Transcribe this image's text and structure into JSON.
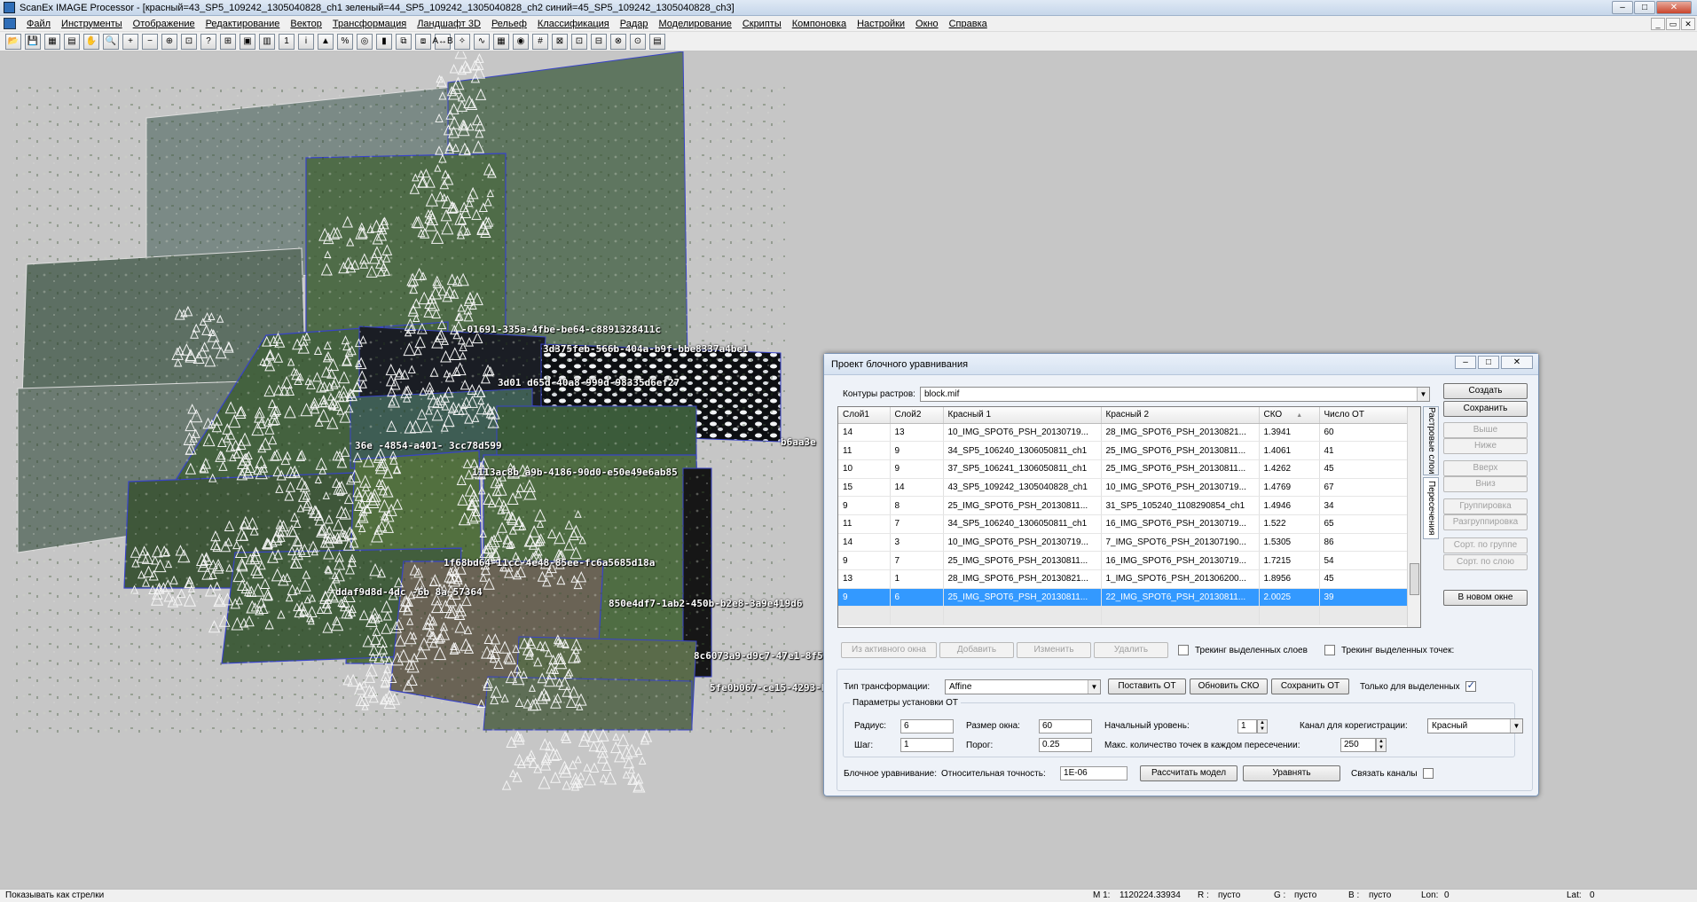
{
  "window": {
    "title": "ScanEx IMAGE Processor - [красный=43_SP5_109242_1305040828_ch1 зеленый=44_SP5_109242_1305040828_ch2 синий=45_SP5_109242_1305040828_ch3]",
    "controls": [
      "–",
      "□",
      "✕"
    ]
  },
  "menu": [
    "Файл",
    "Инструменты",
    "Отображение",
    "Редактирование",
    "Вектор",
    "Трансформация",
    "Ландшафт 3D",
    "Рельеф",
    "Классификация",
    "Радар",
    "Моделирование",
    "Скрипты",
    "Компоновка",
    "Настройки",
    "Окно",
    "Справка"
  ],
  "mdi_controls": [
    "_",
    "▭",
    "✕"
  ],
  "toolbar_icons": [
    "open-icon",
    "save-icon",
    "image-icon",
    "window-icon",
    "hand-icon",
    "zoom-icon",
    "zoom-in-icon",
    "zoom-out-icon",
    "zoom-fit-icon",
    "zoom-rect-icon",
    "measure-icon",
    "frame-icon",
    "overview-icon",
    "layer-icon",
    "one-icon",
    "info-icon",
    "histogram-icon",
    "percent-icon",
    "palette-icon",
    "gradient-icon",
    "copy-icon",
    "paste-icon",
    "ab-icon",
    "rotate-icon",
    "curve-icon",
    "table-icon",
    "globe-icon",
    "grid-icon",
    "stamp-icon",
    "stamp2-icon",
    "stamp3-icon",
    "stamp4-icon",
    "stamp5-icon",
    "list-icon"
  ],
  "toolbar_glyphs": [
    "📂",
    "💾",
    "▦",
    "▤",
    "✋",
    "🔍",
    "+",
    "−",
    "⊕",
    "⊡",
    "?",
    "⊞",
    "▣",
    "▥",
    "1",
    "i",
    "▲",
    "%",
    "◎",
    "▮",
    "⧉",
    "⧈",
    "A↔B",
    "✧",
    "∿",
    "▦",
    "◉",
    "#",
    "⊠",
    "⊡",
    "⊟",
    "⊗",
    "⊙",
    "▤"
  ],
  "map_labels": [
    "-01691-335a-4fbe-be64-c8891328411c",
    "3d375feb-566b-404a-b9f-bbe8337a4be1",
    "3d01      d65d-40a8-999d-98335d6ef27",
    "36e       -4854-a401-      3cc78d599",
    "b6aa3e",
    "1113ac8b    a9b-4186-90d0-e50e49e6ab85",
    "1f68bd64-11cc-4e48-85ee-fc6a5685d18a",
    "ddaf9d8d-4dc   -6b    8a        57364",
    "850e4df7-1ab2-450b-b2e8-3a9e419d6",
    "8c6073a9-d9c7-47e1-8f54-5dd5c6b2d636",
    "5fe0b067-ce15-4293-bd63-0733e4b4db23"
  ],
  "dialog": {
    "title": "Проект блочного уравнивания",
    "contours_label": "Контуры растров:",
    "contours_value": "block.mif",
    "columns": [
      "Слой1",
      "Слой2",
      "Красный 1",
      "Красный 2",
      "СКО",
      "Число ОТ"
    ],
    "sort_indicator": "▲",
    "rows": [
      [
        "14",
        "13",
        "10_IMG_SPOT6_PSH_20130719...",
        "28_IMG_SPOT6_PSH_20130821...",
        "1.3941",
        "60"
      ],
      [
        "11",
        "9",
        "34_SP5_106240_1306050811_ch1",
        "25_IMG_SPOT6_PSH_20130811...",
        "1.4061",
        "41"
      ],
      [
        "10",
        "9",
        "37_SP5_106241_1306050811_ch1",
        "25_IMG_SPOT6_PSH_20130811...",
        "1.4262",
        "45"
      ],
      [
        "15",
        "14",
        "43_SP5_109242_1305040828_ch1",
        "10_IMG_SPOT6_PSH_20130719...",
        "1.4769",
        "67"
      ],
      [
        "9",
        "8",
        "25_IMG_SPOT6_PSH_20130811...",
        "31_SP5_105240_1108290854_ch1",
        "1.4946",
        "34"
      ],
      [
        "11",
        "7",
        "34_SP5_106240_1306050811_ch1",
        "16_IMG_SPOT6_PSH_20130719...",
        "1.522",
        "65"
      ],
      [
        "14",
        "3",
        "10_IMG_SPOT6_PSH_20130719...",
        "7_IMG_SPOT6_PSH_201307190...",
        "1.5305",
        "86"
      ],
      [
        "9",
        "7",
        "25_IMG_SPOT6_PSH_20130811...",
        "16_IMG_SPOT6_PSH_20130719...",
        "1.7215",
        "54"
      ],
      [
        "13",
        "1",
        "28_IMG_SPOT6_PSH_20130821...",
        "1_IMG_SPOT6_PSH_201306200...",
        "1.8956",
        "45"
      ],
      [
        "9",
        "6",
        "25_IMG_SPOT6_PSH_20130811...",
        "22_IMG_SPOT6_PSH_20130811...",
        "2.0025",
        "39"
      ]
    ],
    "selected_row_index": 9,
    "side_tabs": [
      "Растровые слои",
      "Пересечения"
    ],
    "side_buttons": [
      "Создать",
      "Сохранить",
      "Выше",
      "Ниже",
      "Вверх",
      "Вниз",
      "Группировка",
      "Разгруппировка",
      "Сорт. по группе",
      "Сорт. по слою",
      "В новом окне"
    ],
    "action_buttons": [
      "Из активного окна",
      "Добавить",
      "Изменить",
      "Удалить"
    ],
    "track_layers_label": "Трекинг выделенных слоев",
    "track_points_label": "Трекинг выделенных точек:",
    "transform_label": "Тип трансформации:",
    "transform_value": "Affine",
    "btn_set_points": "Поставить ОТ",
    "btn_update_rmse": "Обновить СКО",
    "btn_save_points": "Сохранить ОТ",
    "only_selected_label": "Только для выделенных",
    "params_group": "Параметры установки ОТ",
    "radius_label": "Радиус:",
    "radius_value": "6",
    "window_label": "Размер окна:",
    "window_value": "60",
    "start_level_label": "Начальный уровень:",
    "start_level_value": "1",
    "channel_label": "Канал для корегистрации:",
    "channel_value": "Красный",
    "step_label": "Шаг:",
    "step_value": "1",
    "threshold_label": "Порог:",
    "threshold_value": "0.25",
    "maxpoints_label": "Макс. количество точек в каждом пересечении:",
    "maxpoints_value": "250",
    "block_label": "Блочное уравнивание:",
    "accuracy_label": "Относительная точность:",
    "accuracy_value": "1E-06",
    "btn_compute": "Рассчитать модел",
    "btn_adjust": "Уравнять",
    "link_channels_label": "Связать каналы"
  },
  "status": {
    "hint": "Показывать как стрелки",
    "m_label": "M 1:",
    "m_value": "1120224.33934",
    "r_label": "R :",
    "r_value": "пусто",
    "g_label": "G :",
    "g_value": "пусто",
    "b_label": "B :",
    "b_value": "пусто",
    "lon_label": "Lon:",
    "lon_value": "0",
    "lat_label": "Lat:",
    "lat_value": "0"
  }
}
